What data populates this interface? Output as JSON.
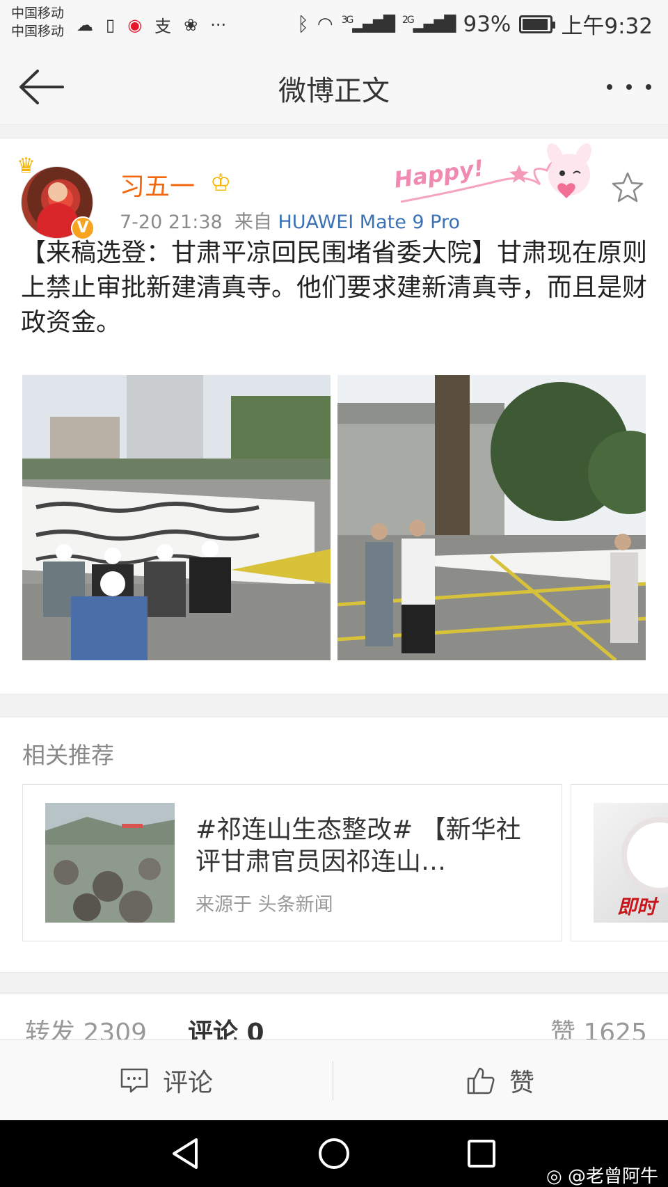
{
  "status_bar": {
    "carrier_1": "中国移动",
    "carrier_2": "中国移动",
    "network_1": "3G",
    "network_2": "2G",
    "battery_percent": "93%",
    "battery_level": 0.93,
    "time": "上午9:32"
  },
  "title_bar": {
    "title": "微博正文"
  },
  "post": {
    "user_name": "习五一",
    "timestamp": "7-20 21:38",
    "source_prefix": "来自",
    "device": "HUAWEI Mate 9 Pro",
    "sticker_text": "Happy!",
    "text": "【来稿选登：甘肃平凉回民围堵省委大院】甘肃现在原则上禁止审批新建清真寺。他们要求建新清真寺，而且是财政资金。",
    "images": [
      {
        "name": "protest-photo-1"
      },
      {
        "name": "protest-photo-2"
      }
    ]
  },
  "related": {
    "title": "相关推荐",
    "cards": [
      {
        "text": "#祁连山生态整改# 【新华社评甘肃官员因祁连山…",
        "source": "来源于 头条新闻"
      },
      {
        "thumb_text": "即时"
      }
    ]
  },
  "stats": {
    "reposts": "转发 2309",
    "comments": "评论 0",
    "likes": "赞 1625"
  },
  "actions": {
    "comment_label": "评论",
    "like_label": "赞"
  },
  "watermark": "@老曾阿牛",
  "colors": {
    "username_orange": "#f2670c",
    "link_blue": "#3b71b5",
    "verified_badge": "#f7a320"
  }
}
